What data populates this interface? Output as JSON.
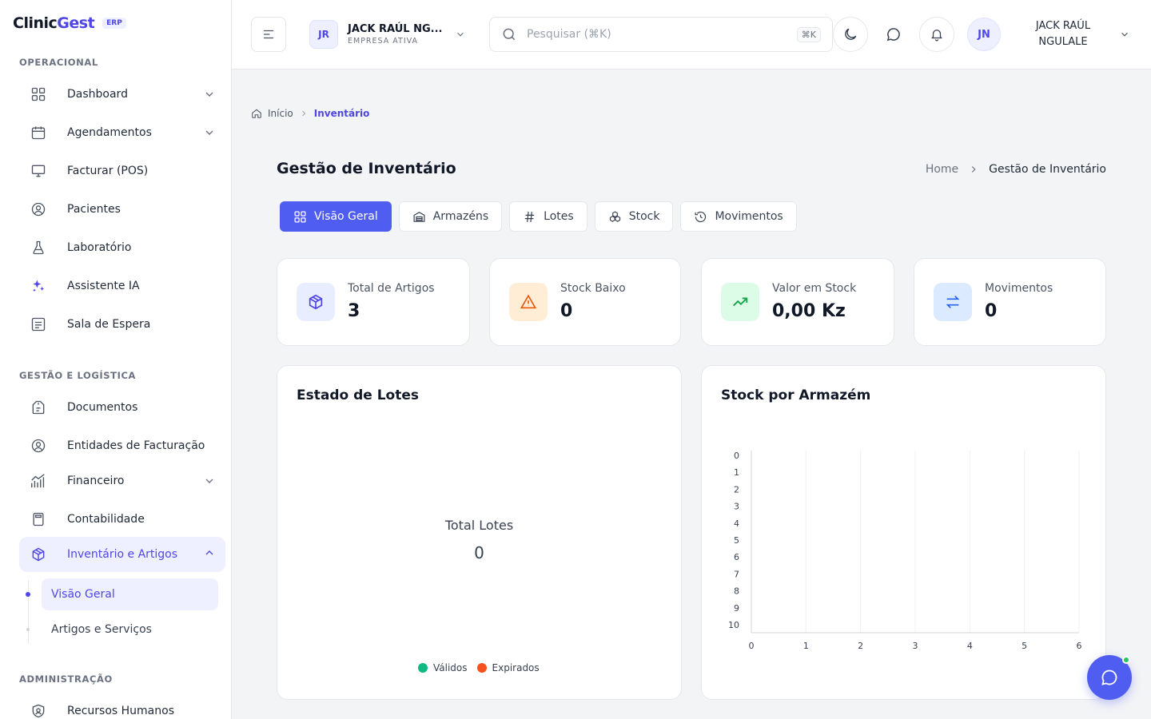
{
  "brand": {
    "name_a": "Clinic",
    "name_b": "Gest",
    "badge": "ERP"
  },
  "sidebar": {
    "sections": [
      "OPERACIONAL",
      "GESTÃO E LOGÍSTICA",
      "ADMINISTRAÇÃO"
    ],
    "items": [
      {
        "label": "Dashboard"
      },
      {
        "label": "Agendamentos"
      },
      {
        "label": "Facturar (POS)"
      },
      {
        "label": "Pacientes"
      },
      {
        "label": "Laboratório"
      },
      {
        "label": "Assistente IA"
      },
      {
        "label": "Sala de Espera"
      },
      {
        "label": "Documentos"
      },
      {
        "label": "Entidades de Facturação"
      },
      {
        "label": "Financeiro"
      },
      {
        "label": "Contabilidade"
      },
      {
        "label": "Inventário e Artigos"
      },
      {
        "label": "Recursos Humanos"
      }
    ],
    "sub_items": [
      {
        "label": "Visão Geral"
      },
      {
        "label": "Artigos e Serviços"
      }
    ]
  },
  "header": {
    "company_initials": "JR",
    "company_name": "JACK RAÚL NG...",
    "company_status": "EMPRESA ATIVA",
    "search_placeholder": "Pesquisar (⌘K)",
    "search_shortcut": "⌘K",
    "user_initials": "JN",
    "user_name_line1": "JACK RAÚL",
    "user_name_line2": "NGULALE"
  },
  "breadcrumb": {
    "home": "Início",
    "current": "Inventário"
  },
  "page": {
    "title": "Gestão de Inventário",
    "crumb_home": "Home",
    "crumb_current": "Gestão de Inventário"
  },
  "tabs": [
    {
      "label": "Visão Geral"
    },
    {
      "label": "Armazéns"
    },
    {
      "label": "Lotes"
    },
    {
      "label": "Stock"
    },
    {
      "label": "Movimentos"
    }
  ],
  "stats": [
    {
      "label": "Total de Artigos",
      "value": "3",
      "color": "#4f46e5",
      "bg": "#e8edff",
      "icon": "cube-icon"
    },
    {
      "label": "Stock Baixo",
      "value": "0",
      "color": "#ea580c",
      "bg": "#ffedd5",
      "icon": "warning-icon"
    },
    {
      "label": "Valor em Stock",
      "value": "0,00 Kz",
      "color": "#16a34a",
      "bg": "#dcfce7",
      "icon": "trending-up-icon"
    },
    {
      "label": "Movimentos",
      "value": "0",
      "color": "#2563eb",
      "bg": "#dbeafe",
      "icon": "arrows-swap-icon"
    }
  ],
  "lots_card": {
    "title": "Estado de Lotes",
    "center_label": "Total Lotes",
    "center_value": "0",
    "legend": [
      {
        "name": "Válidos",
        "color": "#10b981"
      },
      {
        "name": "Expirados",
        "color": "#f4511e"
      }
    ]
  },
  "chart_data": {
    "type": "bar",
    "title": "Stock por Armazém",
    "orientation": "horizontal",
    "categories": [],
    "values": [],
    "xlim": [
      0,
      6
    ],
    "x_ticks": [
      "0",
      "1",
      "2",
      "3",
      "4",
      "5",
      "6"
    ],
    "y_ticks": [
      "0",
      "1",
      "2",
      "3",
      "4",
      "5",
      "6",
      "7",
      "8",
      "9",
      "10"
    ],
    "grid": true
  },
  "colors": {
    "accent": "#4f5ef0",
    "online": "#22c55e"
  }
}
